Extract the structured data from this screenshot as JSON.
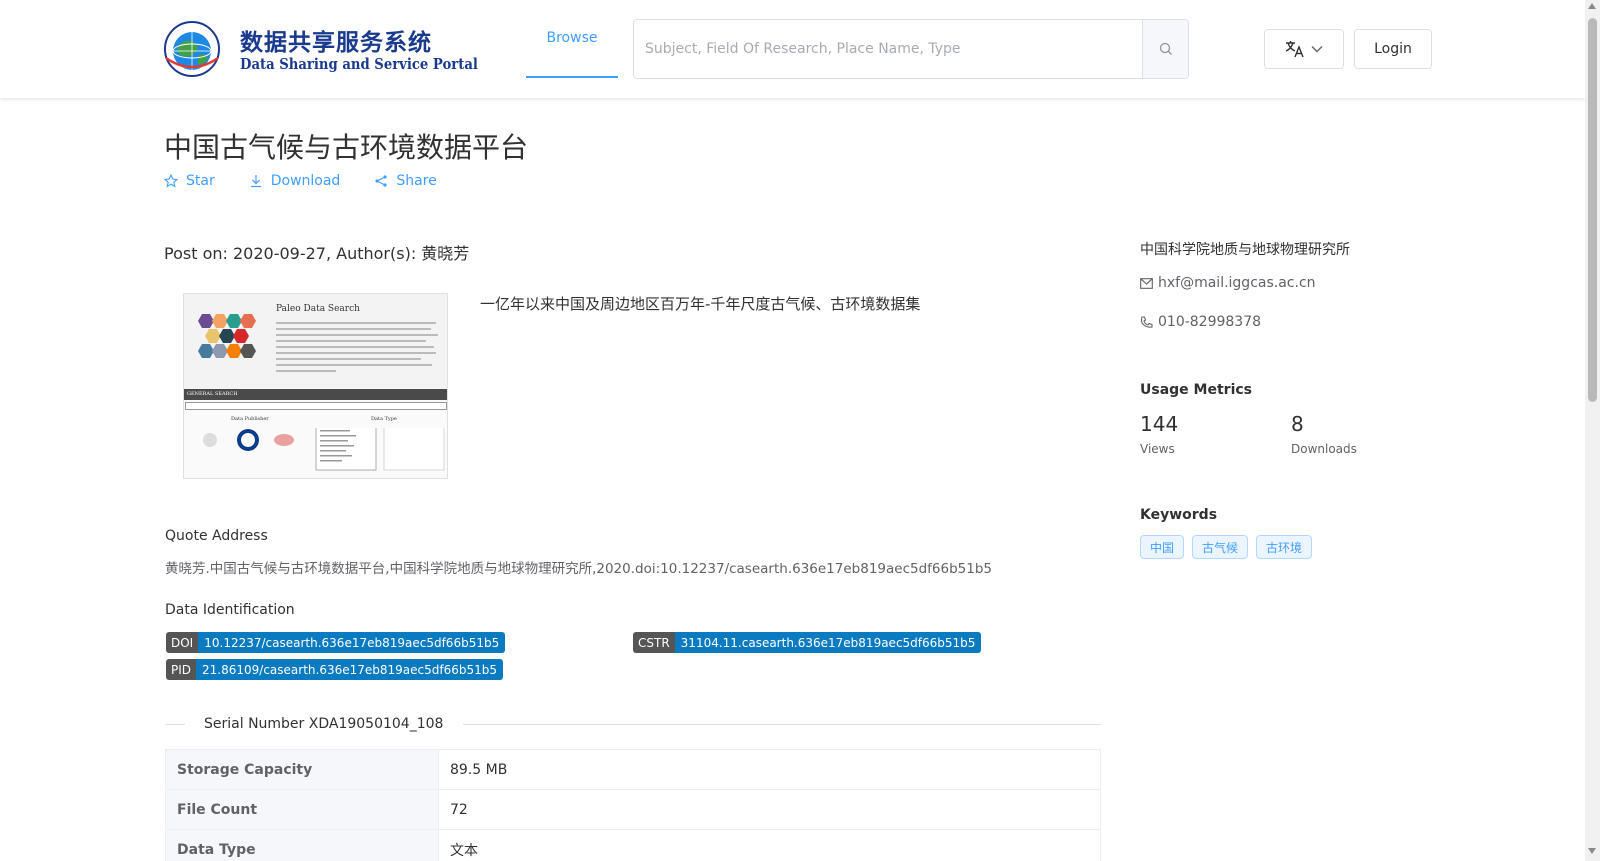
{
  "header": {
    "logo_cn": "数据共享服务系统",
    "logo_en": "Data Sharing and Service Portal",
    "logo_ring_text": "地球大数据科学工程数据中心",
    "logo_ring_text_en": "Big Earth Data Center",
    "nav_browse": "Browse",
    "search_placeholder": "Subject, Field Of Research, Place Name, Type",
    "login_label": "Login",
    "accent_color": "#409eff"
  },
  "dataset": {
    "title": "中国古气候与古环境数据平台",
    "actions": {
      "star": "Star",
      "download": "Download",
      "share": "Share"
    },
    "post_info": "Post on: 2020-09-27, Author(s): 黄晓芳",
    "description": "一亿年以来中国及周边地区百万年-千年尺度古气候、古环境数据集",
    "thumbnail": {
      "heading": "Paleo Data Search",
      "bar_label": "GENERAL SEARCH",
      "label_publisher": "Data Publisher",
      "label_type": "Data Type"
    },
    "quote_label": "Quote Address",
    "quote_text": "黄晓芳.中国古气候与古环境数据平台,中国科学院地质与地球物理研究所,2020.doi:10.12237/casearth.636e17eb819aec5df66b51b5",
    "identification_label": "Data Identification",
    "ids": [
      {
        "key": "DOI",
        "value": "10.12237/casearth.636e17eb819aec5df66b51b5"
      },
      {
        "key": "CSTR",
        "value": "31104.11.casearth.636e17eb819aec5df66b51b5"
      },
      {
        "key": "PID",
        "value": "21.86109/casearth.636e17eb819aec5df66b51b5"
      }
    ],
    "serial": "Serial Number XDA19050104_108",
    "table": [
      {
        "key": "Storage Capacity",
        "value": "89.5 MB"
      },
      {
        "key": "File Count",
        "value": "72"
      },
      {
        "key": "Data Type",
        "value": "文本"
      }
    ]
  },
  "sidebar": {
    "organization": "中国科学院地质与地球物理研究所",
    "email": "hxf@mail.iggcas.ac.cn",
    "phone": "010-82998378",
    "metrics_heading": "Usage Metrics",
    "views_count": "144",
    "views_label": "Views",
    "downloads_count": "8",
    "downloads_label": "Downloads",
    "keywords_heading": "Keywords",
    "keywords": [
      "中国",
      "古气候",
      "古环境"
    ]
  }
}
